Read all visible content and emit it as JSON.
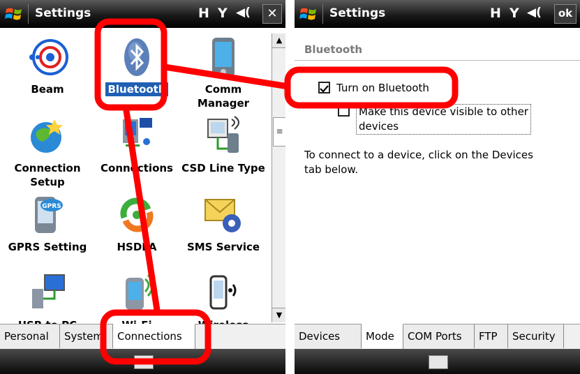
{
  "left": {
    "title": "Settings",
    "indicators": [
      "H",
      "Y",
      "◀("
    ],
    "close_label": "✕",
    "items": [
      {
        "label": "Beam",
        "icon": "beam-icon"
      },
      {
        "label": "Bluetooth",
        "icon": "bluetooth-icon",
        "selected": true
      },
      {
        "label": "Comm Manager",
        "icon": "comm-manager-icon"
      },
      {
        "label": "Connection Setup",
        "icon": "connection-setup-icon"
      },
      {
        "label": "Connections",
        "icon": "connections-icon"
      },
      {
        "label": "CSD Line Type",
        "icon": "csd-line-type-icon"
      },
      {
        "label": "GPRS Setting",
        "icon": "gprs-setting-icon"
      },
      {
        "label": "HSDPA",
        "icon": "hsdpa-icon"
      },
      {
        "label": "SMS Service",
        "icon": "sms-service-icon"
      },
      {
        "label": "USB to PC",
        "icon": "usb-to-pc-icon"
      },
      {
        "label": "Wi-Fi",
        "icon": "wifi-icon"
      },
      {
        "label": "Wireless",
        "icon": "wireless-icon"
      }
    ],
    "tabs": [
      "Personal",
      "System",
      "Connections"
    ],
    "active_tab": "Connections"
  },
  "right": {
    "title": "Settings",
    "indicators": [
      "H",
      "Y",
      "◀("
    ],
    "ok_label": "ok",
    "section": "Bluetooth",
    "turn_on_label": "Turn on Bluetooth",
    "turn_on_checked": true,
    "visible_label_1": "Make this device visible to other",
    "visible_label_2": "devices",
    "visible_checked": false,
    "info_1": "To connect to a device, click on the Devices",
    "info_2": "tab below.",
    "tabs": [
      "Devices",
      "Mode",
      "COM Ports",
      "FTP",
      "Security"
    ],
    "active_tab": "Mode"
  },
  "colors": {
    "highlight": "#ff0000",
    "selection": "#1f5fb4"
  }
}
